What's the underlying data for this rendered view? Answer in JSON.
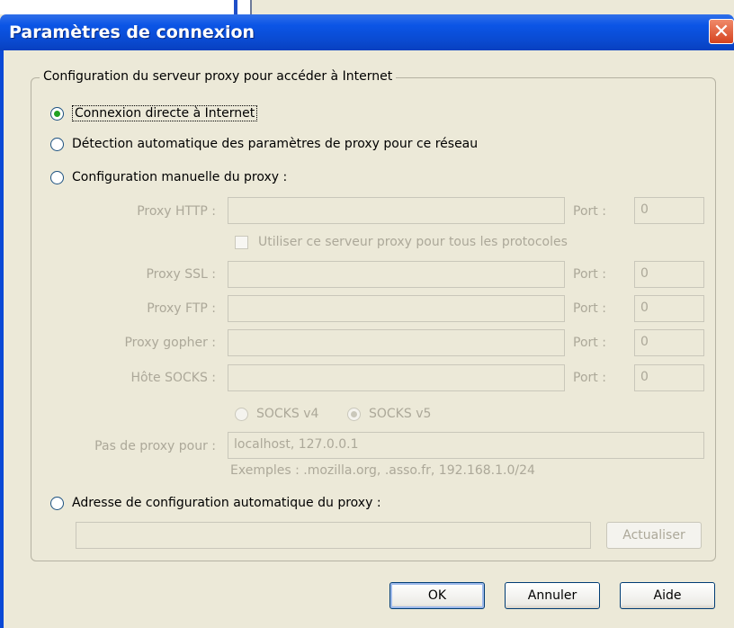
{
  "window": {
    "title": "Paramètres de connexion",
    "close_symbol": "✕"
  },
  "group": {
    "legend": "Configuration du serveur proxy pour accéder à Internet"
  },
  "radios": {
    "direct": {
      "label": "Connexion directe à Internet",
      "checked": true
    },
    "auto_detect": {
      "label": "Détection automatique des paramètres de proxy pour ce réseau",
      "checked": false
    },
    "manual": {
      "label": "Configuration manuelle du proxy :",
      "checked": false
    },
    "auto_url": {
      "label": "Adresse de configuration automatique du proxy :",
      "checked": false
    }
  },
  "manual": {
    "http_label": "Proxy HTTP :",
    "http_value": "",
    "http_port_label": "Port :",
    "http_port": "0",
    "all_protocols_label": "Utiliser ce serveur proxy pour tous les protocoles",
    "ssl_label": "Proxy SSL :",
    "ssl_value": "",
    "ssl_port_label": "Port :",
    "ssl_port": "0",
    "ftp_label": "Proxy FTP :",
    "ftp_value": "",
    "ftp_port_label": "Port :",
    "ftp_port": "0",
    "gopher_label": "Proxy gopher :",
    "gopher_value": "",
    "gopher_port_label": "Port :",
    "gopher_port": "0",
    "socks_label": "Hôte SOCKS :",
    "socks_value": "",
    "socks_port_label": "Port :",
    "socks_port": "0",
    "socks_v4_label": "SOCKS v4",
    "socks_v5_label": "SOCKS v5",
    "no_proxy_label": "Pas de proxy pour :",
    "no_proxy_value": "localhost, 127.0.0.1",
    "examples": "Exemples : .mozilla.org, .asso.fr, 192.168.1.0/24"
  },
  "auto_url": {
    "value": "",
    "reload_label": "Actualiser"
  },
  "buttons": {
    "ok": "OK",
    "cancel": "Annuler",
    "help": "Aide"
  },
  "colors": {
    "title_bar": "#0a4bd2",
    "dialog_bg": "#ece9d8",
    "disabled_text": "#aca899",
    "radio_check": "#21a121"
  }
}
